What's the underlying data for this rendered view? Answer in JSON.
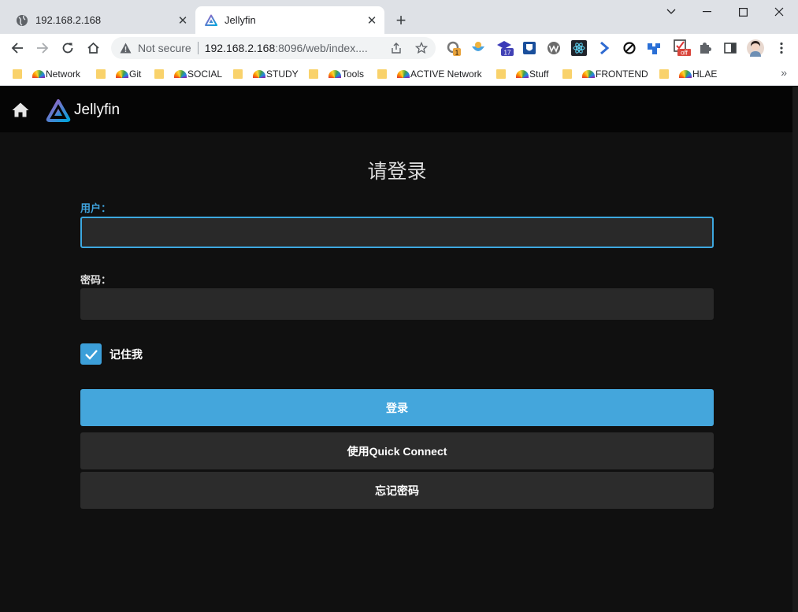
{
  "browser": {
    "tabs": [
      {
        "title": "192.168.2.168",
        "active": false
      },
      {
        "title": "Jellyfin",
        "active": true
      }
    ],
    "address": {
      "security_label": "Not secure",
      "host": "192.168.2.168",
      "path": ":8096/web/index...."
    },
    "bookmarks": [
      {
        "label": "Network"
      },
      {
        "label": "Git"
      },
      {
        "label": "SOCIAL"
      },
      {
        "label": "STUDY"
      },
      {
        "label": "Tools"
      },
      {
        "label": "ACTIVE Network"
      },
      {
        "label": "Stuff"
      },
      {
        "label": "FRONTEND"
      },
      {
        "label": "HLAE"
      }
    ],
    "extension_badges": {
      "first": "1",
      "second": "17",
      "off": "off"
    }
  },
  "app": {
    "name": "Jellyfin",
    "accent_color": "#44a6dc"
  },
  "login": {
    "title": "请登录",
    "username_label": "用户：",
    "username_value": "",
    "password_label": "密码：",
    "password_value": "",
    "remember_label": "记住我",
    "remember_checked": true,
    "submit_label": "登录",
    "quick_connect_label": "使用Quick Connect",
    "forgot_label": "忘记密码"
  }
}
